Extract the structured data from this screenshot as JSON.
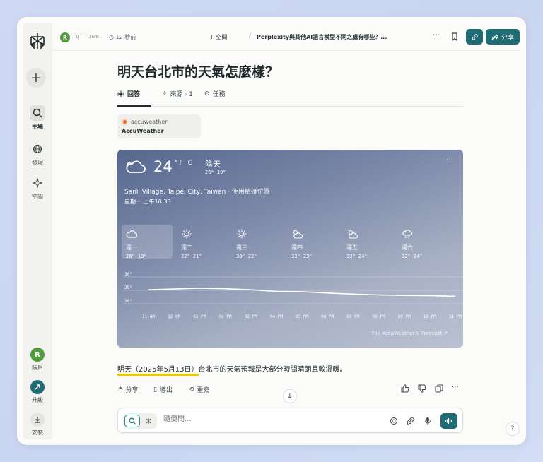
{
  "sidebar": {
    "new_label": "+",
    "items": [
      {
        "id": "home",
        "label": "主場",
        "icon": "search-icon"
      },
      {
        "id": "discover",
        "label": "發現",
        "icon": "globe-icon"
      },
      {
        "id": "spaces",
        "label": "空間",
        "icon": "sparkle-icon"
      }
    ],
    "account": {
      "initial": "R",
      "label": "賬戶"
    },
    "upgrade": {
      "label": "升級"
    },
    "install": {
      "label": "安裝"
    }
  },
  "topbar": {
    "avatar_initial": "R",
    "user": "ʹɥʹ ˙ɹɐɐ",
    "time": "12 秒前",
    "space": "+ 空間",
    "slash": "/",
    "thread": "Perplexity與其他AI語言模型不同之處有哪些？...",
    "more": "···",
    "share_label": "分享"
  },
  "main": {
    "title": "明天台北市的天氣怎麼樣？",
    "tabs": [
      {
        "label": "回答",
        "icon": "answer-icon"
      },
      {
        "label": "來源 · 1",
        "icon": "sources-icon"
      },
      {
        "label": "任務",
        "icon": "tasks-icon"
      }
    ],
    "source": {
      "domain": "accuweather",
      "name": "AccuWeather"
    }
  },
  "weather": {
    "temp": "24",
    "unit": "°F C",
    "condition": "陰天",
    "hilo": "26°  19°",
    "more": "···",
    "location": "Sanli Village, Taipei City, Taiwan",
    "location_sub": " · 使用精確位置",
    "datetime": "星期一 上午10:33",
    "days": [
      {
        "name": "週一",
        "temps": "26°  19°",
        "icon": "cloudy-icon"
      },
      {
        "name": "週二",
        "temps": "32°  21°",
        "icon": "sunny-icon"
      },
      {
        "name": "週三",
        "temps": "33°  22°",
        "icon": "sunny-icon"
      },
      {
        "name": "週四",
        "temps": "33°  23°",
        "icon": "partly-sunny-icon"
      },
      {
        "name": "週五",
        "temps": "33°  24°",
        "icon": "partly-sunny-icon"
      },
      {
        "name": "週六",
        "temps": "32°  24°",
        "icon": "rain-icon"
      }
    ],
    "footer": "The AccuWeather® Forecast ↗"
  },
  "chart_data": {
    "type": "line",
    "x": [
      "11 AM",
      "12 PM",
      "01 PM",
      "02 PM",
      "03 PM",
      "04 PM",
      "05 PM",
      "06 PM",
      "07 PM",
      "08 PM",
      "09 PM",
      "10 PM",
      "11 PM"
    ],
    "values": [
      25.2,
      25.5,
      25.8,
      25.6,
      25.2,
      24.6,
      24.5,
      24.0,
      23.6,
      23.3,
      23.1,
      23.0,
      22.8
    ],
    "ytick_labels": [
      "30°",
      "25°",
      "20°"
    ],
    "ylim": [
      18,
      34
    ],
    "grid": true
  },
  "answer": {
    "highlight": "明天（2025年5月13日）",
    "rest": "台北市的天氣預報是大部分時間晴朗且較溫暖。"
  },
  "actions": {
    "share": "分享",
    "export": "導出",
    "rewrite": "重寫"
  },
  "input": {
    "placeholder": "隨便問..."
  },
  "help": "?"
}
